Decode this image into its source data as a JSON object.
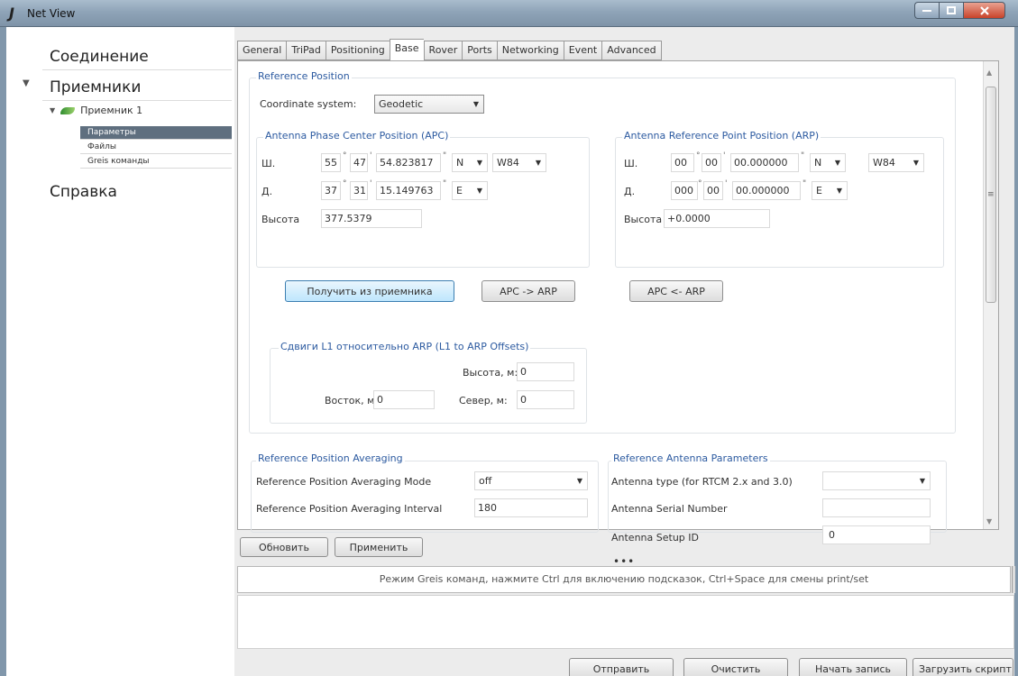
{
  "window": {
    "title": "Net View",
    "logo": "J"
  },
  "sidebar": {
    "connection": "Соединение",
    "receivers": "Приемники",
    "receiver1": "Приемник 1",
    "children": [
      "Параметры",
      "Файлы",
      "Greis команды"
    ],
    "help": "Справка"
  },
  "tabs": [
    "General",
    "TriPad",
    "Positioning",
    "Base",
    "Rover",
    "Ports",
    "Networking",
    "Event",
    "Advanced"
  ],
  "active_tab": "Base",
  "refpos": {
    "title": "Reference Position",
    "coord_label": "Coordinate system:",
    "coord_value": "Geodetic",
    "apc": {
      "title": "Antenna Phase Center Position (APC)",
      "lat_label": "Ш.",
      "lat_deg": "55",
      "lat_min": "47",
      "lat_sec": "54.823817",
      "lat_hem": "N",
      "datum": "W84",
      "lon_label": "Д.",
      "lon_deg": "37",
      "lon_min": "31",
      "lon_sec": "15.149763",
      "lon_hem": "E",
      "height_label": "Высота",
      "height": "377.5379"
    },
    "arp": {
      "title": "Antenna Reference Point Position (ARP)",
      "lat_label": "Ш.",
      "lat_deg": "00",
      "lat_min": "00",
      "lat_sec": "00.000000",
      "lat_hem": "N",
      "datum": "W84",
      "lon_label": "Д.",
      "lon_deg": "000",
      "lon_min": "00",
      "lon_sec": "00.000000",
      "lon_hem": "E",
      "height_label": "Высота",
      "height": "+0.0000"
    },
    "get_button": "Получить из приемника",
    "apc_to_arp": "APC -> ARP",
    "arp_to_apc": "APC <- ARP",
    "offsets": {
      "title": "Сдвиги L1 относительно ARP (L1 to ARP Offsets)",
      "height_label": "Высота, м:",
      "height": "0",
      "east_label": "Восток, м:",
      "east": "0",
      "north_label": "Север, м:",
      "north": "0"
    }
  },
  "averaging": {
    "title": "Reference Position Averaging",
    "mode_label": "Reference Position Averaging Mode",
    "mode": "off",
    "interval_label": "Reference Position Averaging Interval",
    "interval": "180"
  },
  "antenna": {
    "title": "Reference Antenna Parameters",
    "type_label": "Antenna type (for RTCM 2.x and 3.0)",
    "type": "",
    "serial_label": "Antenna Serial Number",
    "serial": "",
    "setup_label": "Antenna Setup ID",
    "setup": "0"
  },
  "actions": {
    "refresh": "Обновить",
    "apply": "Применить"
  },
  "command": {
    "splitter": "•••",
    "hint": "Режим Greis команд, нажмите  Ctrl для включению подсказок, Ctrl+Space для смены print/set",
    "send": "Отправить",
    "clear": "Очистить",
    "record": "Начать запись",
    "load": "Загрузить скрипт"
  }
}
